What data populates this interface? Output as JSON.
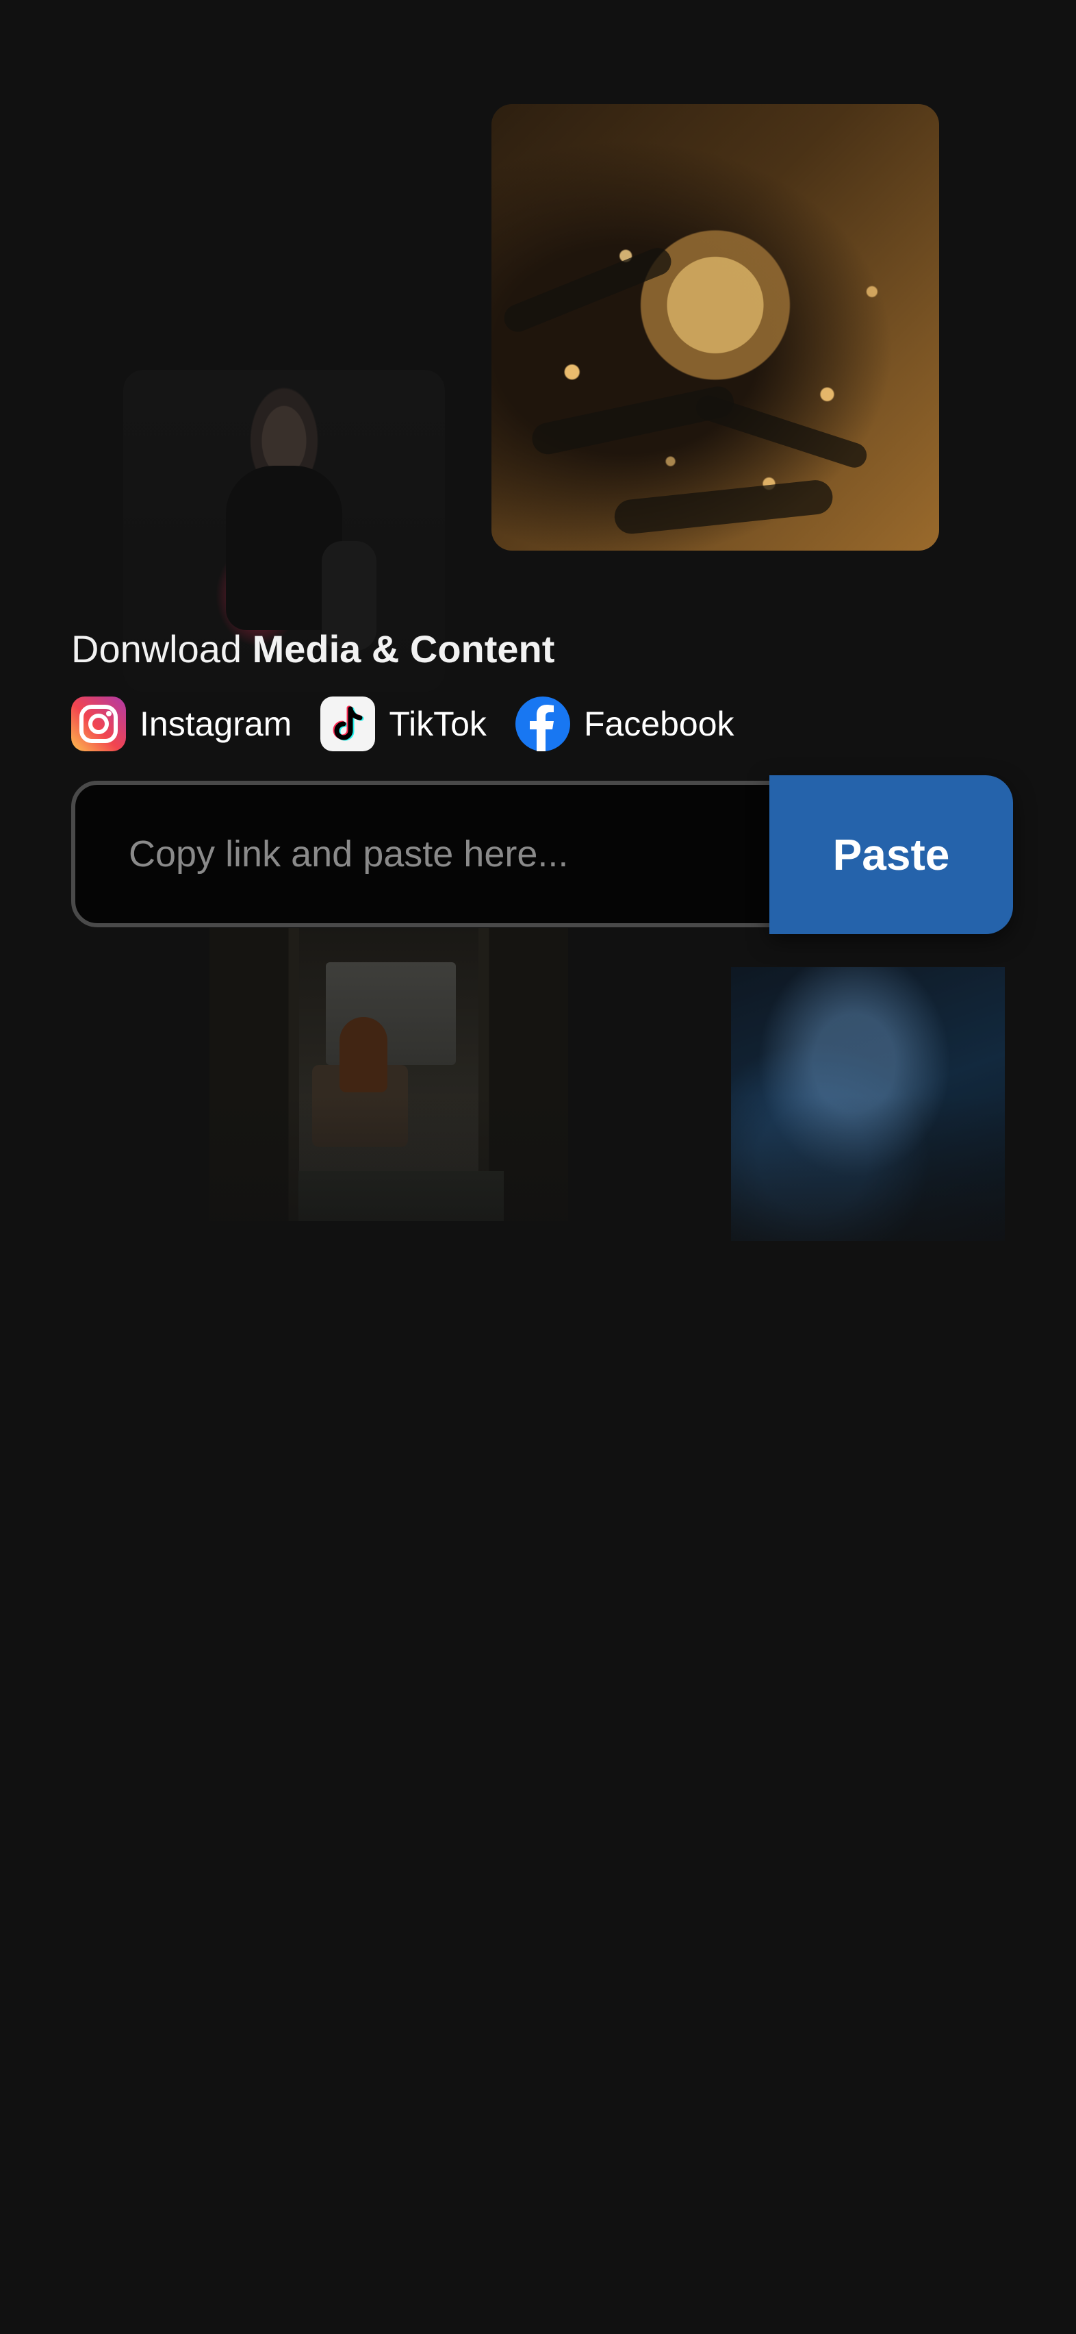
{
  "headline": {
    "prefix": "Donwload",
    "emphasis": "Media & Content"
  },
  "platforms": [
    {
      "label": "Instagram",
      "icon": "instagram-icon"
    },
    {
      "label": "TikTok",
      "icon": "tiktok-icon"
    },
    {
      "label": "Facebook",
      "icon": "facebook-icon"
    }
  ],
  "link_input": {
    "value": "",
    "placeholder": "Copy link and paste here..."
  },
  "paste_button": {
    "label": "Paste"
  },
  "colors": {
    "background": "#111111",
    "accent": "#2563ab",
    "input_border": "#4a4a4a",
    "facebook_blue": "#1877f2"
  }
}
